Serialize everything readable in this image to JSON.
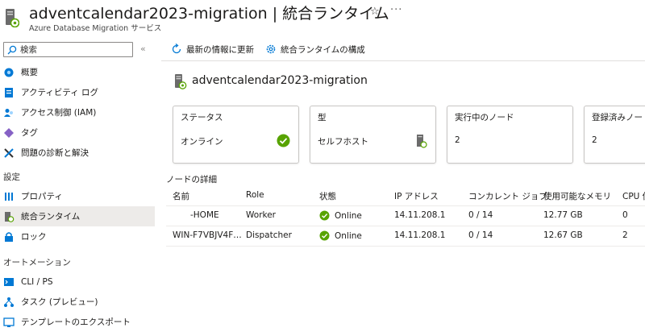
{
  "header": {
    "title": "adventcalendar2023-migration | 統合ランタイム",
    "subtitle": "Azure Database Migration サービス"
  },
  "sidebar": {
    "search_placeholder": "検索",
    "items_top": [
      {
        "label": "概要",
        "icon": "overview-icon"
      },
      {
        "label": "アクティビティ ログ",
        "icon": "activity-log-icon"
      },
      {
        "label": "アクセス制御 (IAM)",
        "icon": "iam-icon"
      },
      {
        "label": "タグ",
        "icon": "tag-icon"
      },
      {
        "label": "問題の診断と解決",
        "icon": "diagnose-icon"
      }
    ],
    "section_settings": "設定",
    "items_settings": [
      {
        "label": "プロパティ",
        "icon": "properties-icon"
      },
      {
        "label": "統合ランタイム",
        "icon": "integration-runtime-icon",
        "active": true
      },
      {
        "label": "ロック",
        "icon": "lock-icon"
      }
    ],
    "section_automation": "オートメーション",
    "items_automation": [
      {
        "label": "CLI / PS",
        "icon": "cli-icon"
      },
      {
        "label": "タスク (プレビュー)",
        "icon": "tasks-icon"
      },
      {
        "label": "テンプレートのエクスポート",
        "icon": "export-template-icon"
      }
    ]
  },
  "toolbar": {
    "refresh_label": "最新の情報に更新",
    "configure_label": "統合ランタイムの構成"
  },
  "runtime": {
    "name": "adventcalendar2023-migration"
  },
  "cards": [
    {
      "title": "ステータス",
      "value": "オンライン",
      "icon": "check-circle-icon"
    },
    {
      "title": "型",
      "value": "セルフホスト",
      "icon": "server-icon"
    },
    {
      "title": "実行中のノード",
      "value": "2"
    },
    {
      "title": "登録済みノード",
      "value": "2"
    }
  ],
  "nodes": {
    "section_title": "ノードの詳細",
    "columns": [
      "名前",
      "Role",
      "状態",
      "IP アドレス",
      "コンカレント ジョブ",
      "使用可能なメモリ",
      "CPU 使"
    ],
    "rows": [
      {
        "name": "-HOME",
        "role": "Worker",
        "status": "Online",
        "ip": "14.11.208.1",
        "jobs": "0 / 14",
        "memory": "12.77 GB",
        "cpu": "0"
      },
      {
        "name": "WIN-F7VBJV4F…",
        "role": "Dispatcher",
        "status": "Online",
        "ip": "14.11.208.1",
        "jobs": "0 / 14",
        "memory": "12.67 GB",
        "cpu": "2"
      }
    ]
  },
  "colors": {
    "accent": "#0078d4",
    "success": "#57a300",
    "active_bg": "#edebe9",
    "border": "#c8c6c4"
  }
}
